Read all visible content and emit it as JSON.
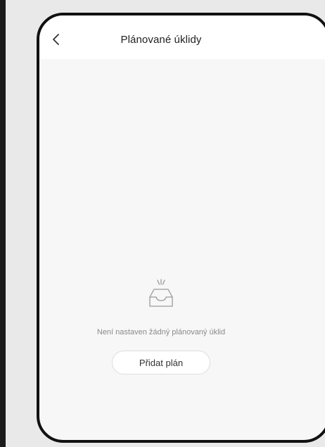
{
  "header": {
    "title": "Plánované úklidy",
    "back_icon": "chevron-left-icon"
  },
  "empty_state": {
    "icon": "empty-inbox-icon",
    "message": "Není nastaven žádný plánovaný úklid",
    "button_label": "Přidat plán"
  },
  "colors": {
    "background": "#f7f7f7",
    "header": "#ffffff",
    "frame": "#111111",
    "muted_text": "#8a8a8a"
  }
}
